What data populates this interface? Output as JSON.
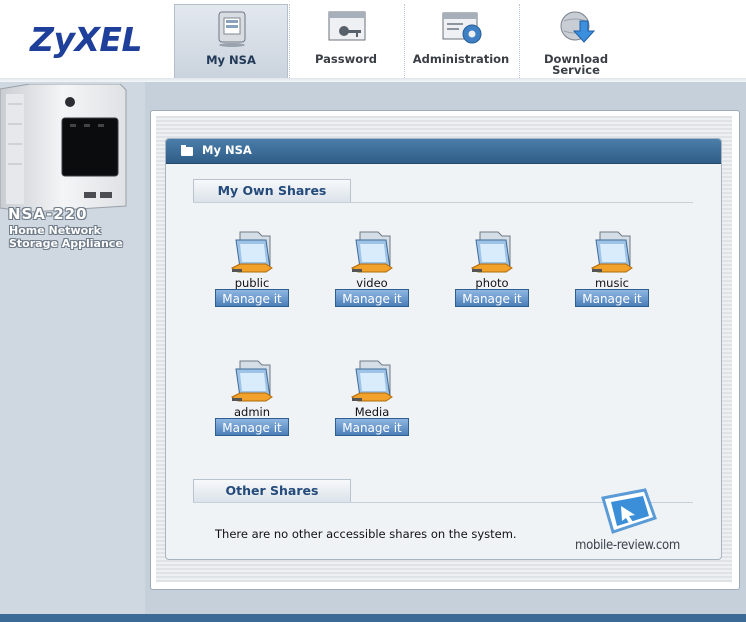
{
  "brand": {
    "logo_text": "ZyXEL"
  },
  "nav": [
    {
      "label": "My NSA",
      "icon": "monitor-icon",
      "active": true
    },
    {
      "label": "Password",
      "icon": "key-window-icon",
      "active": false
    },
    {
      "label": "Administration",
      "icon": "gear-window-icon",
      "active": false
    },
    {
      "label": "Download Service",
      "icon": "download-globe-icon",
      "active": false
    }
  ],
  "device": {
    "model": "NSA-220",
    "description": "Home Network Storage Appliance"
  },
  "panel": {
    "title": "My NSA",
    "own_shares_header": "My Own Shares",
    "other_shares_header": "Other Shares",
    "manage_label": "Manage it",
    "shares": [
      "public",
      "video",
      "photo",
      "music",
      "admin",
      "Media"
    ],
    "no_other_shares_text": "There are no other accessible shares on the system."
  },
  "watermark": {
    "text": "mobile-review.com"
  },
  "colors": {
    "accent": "#2f5d87",
    "button": "#4b7fb9",
    "logo": "#1e3f9a"
  }
}
